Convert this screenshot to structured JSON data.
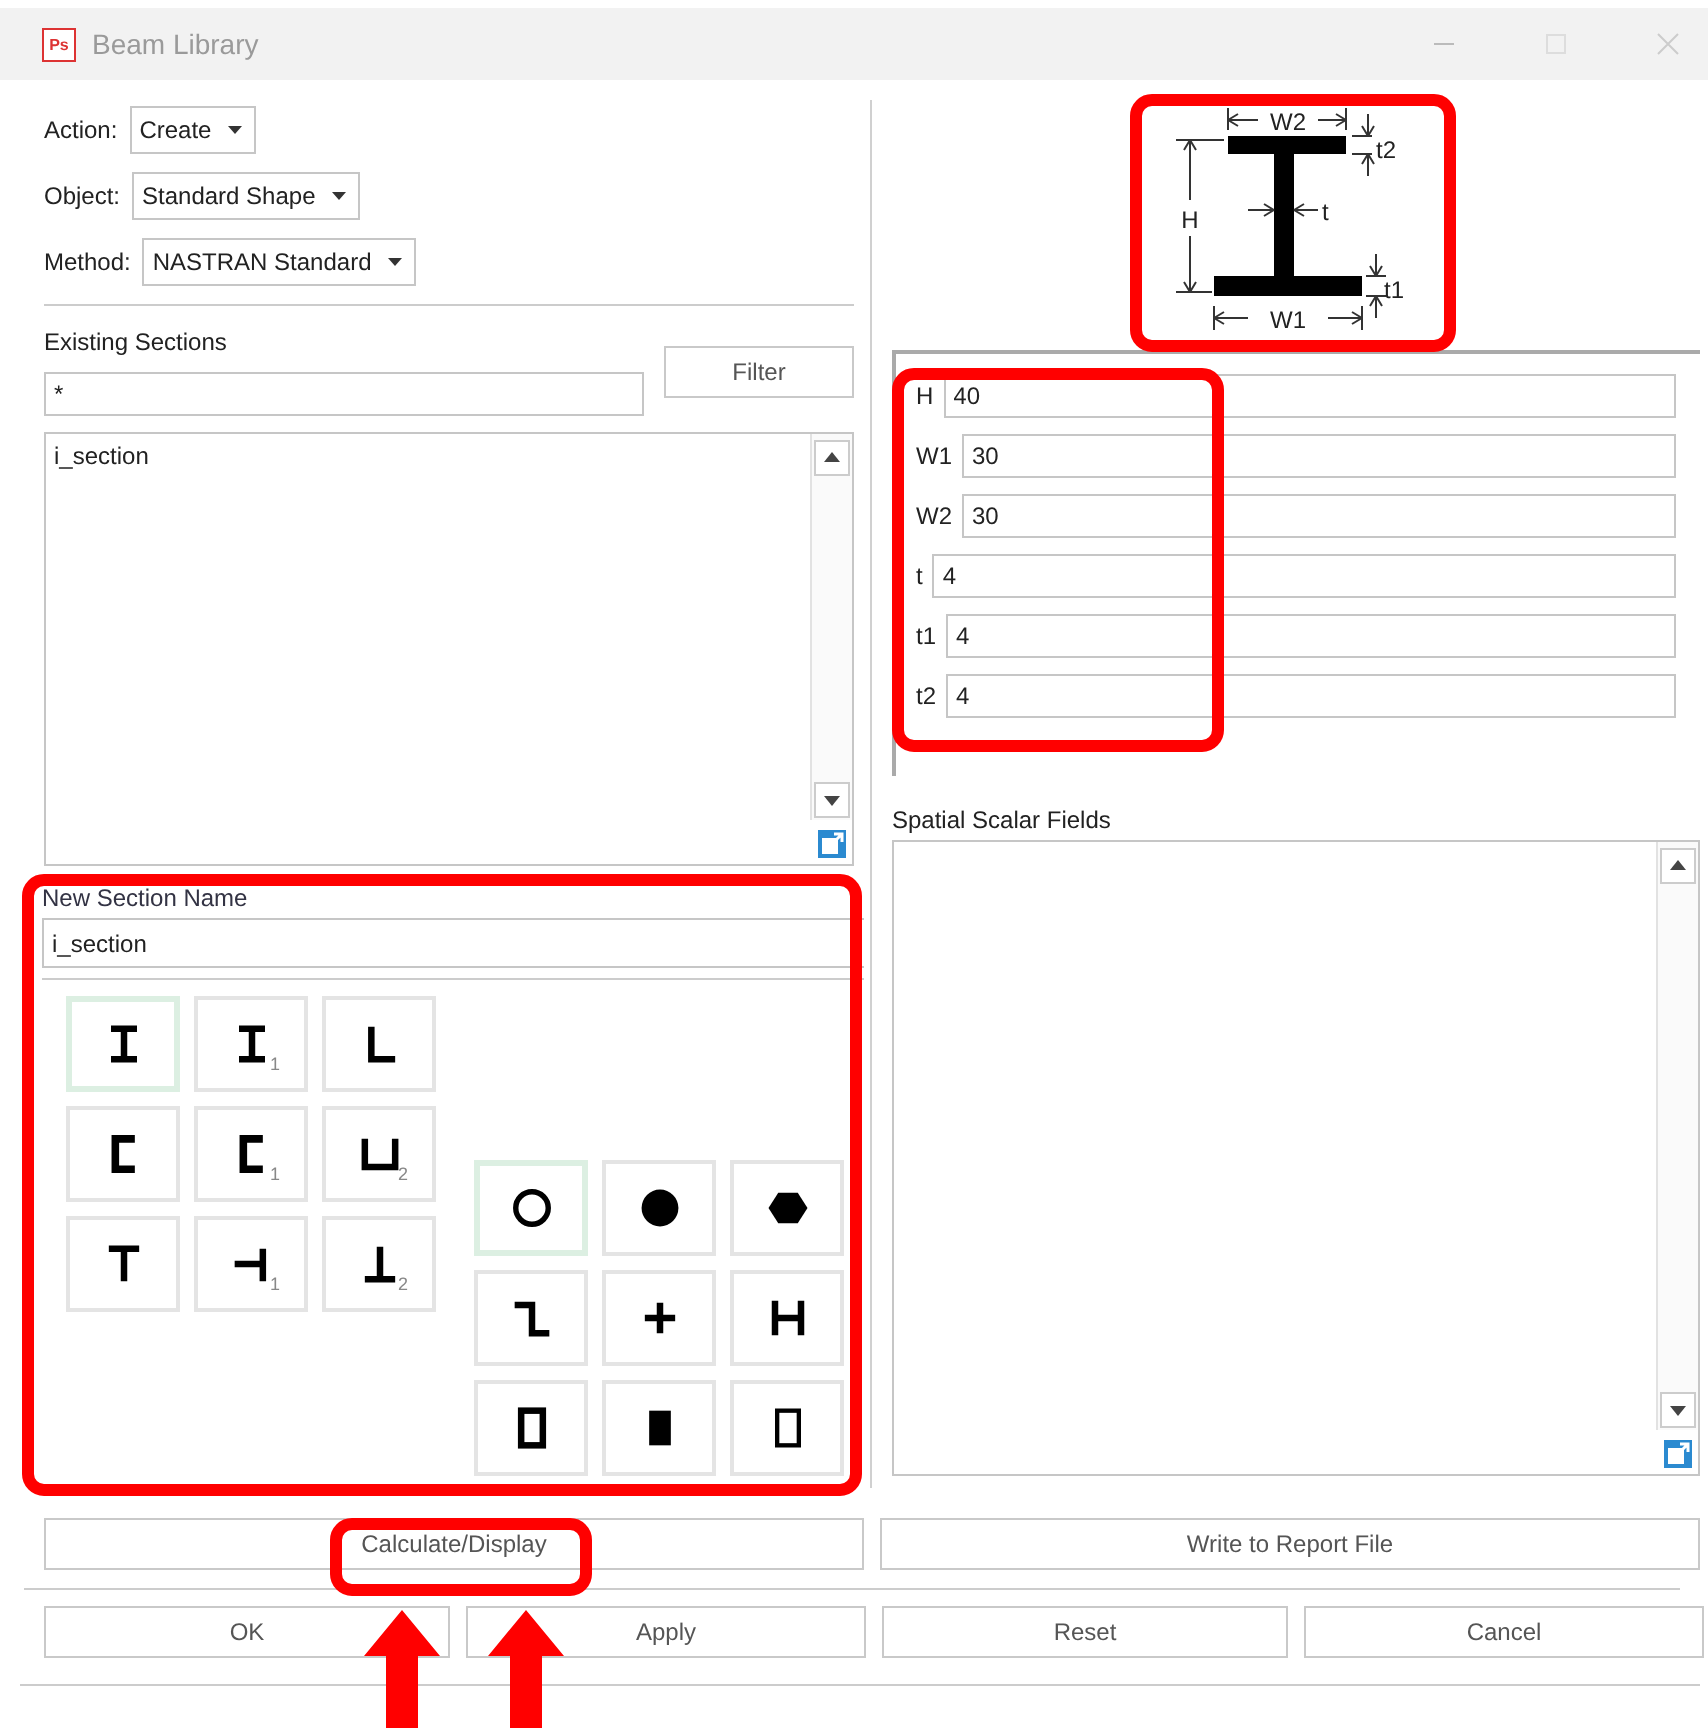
{
  "window": {
    "app_icon": "Ps",
    "title": "Beam Library"
  },
  "form": [
    {
      "label": "Action:",
      "value": "Create"
    },
    {
      "label": "Object:",
      "value": "Standard Shape"
    },
    {
      "label": "Method:",
      "value": "NASTRAN Standard"
    }
  ],
  "existing_sections": {
    "label": "Existing Sections",
    "filter_value": "*",
    "filter_button": "Filter",
    "items": [
      "i_section"
    ]
  },
  "new_section": {
    "label": "New Section Name",
    "value": "i_section"
  },
  "shapes_left": [
    {
      "kind": "i",
      "selected": true
    },
    {
      "kind": "i",
      "sub": "1",
      "selected": false
    },
    {
      "kind": "l",
      "selected": false
    },
    {
      "kind": "c",
      "selected": false
    },
    {
      "kind": "c",
      "sub": "1",
      "selected": false
    },
    {
      "kind": "u",
      "sub": "2",
      "selected": false
    },
    {
      "kind": "t",
      "selected": false
    },
    {
      "kind": "sidetee",
      "sub": "1",
      "selected": false
    },
    {
      "kind": "invt",
      "sub": "2",
      "selected": false
    }
  ],
  "shapes_right": [
    {
      "kind": "tube",
      "selected": true
    },
    {
      "kind": "rod",
      "selected": false
    },
    {
      "kind": "hex",
      "selected": false
    },
    {
      "kind": "z",
      "selected": false
    },
    {
      "kind": "cross",
      "selected": false
    },
    {
      "kind": "h",
      "selected": false
    },
    {
      "kind": "box",
      "selected": false
    },
    {
      "kind": "bar",
      "selected": false
    },
    {
      "kind": "thinbox",
      "selected": false
    }
  ],
  "diagram": {
    "labels": [
      "W2",
      "t2",
      "H",
      "t",
      "t1",
      "W1"
    ]
  },
  "parameters": [
    {
      "label": "H",
      "value": "40"
    },
    {
      "label": "W1",
      "value": "30"
    },
    {
      "label": "W2",
      "value": "30"
    },
    {
      "label": "t",
      "value": "4"
    },
    {
      "label": "t1",
      "value": "4"
    },
    {
      "label": "t2",
      "value": "4"
    }
  ],
  "spatial_scalar_fields": {
    "label": "Spatial Scalar Fields"
  },
  "actions": [
    "Calculate/Display",
    "Write to Report File"
  ],
  "buttons": [
    "OK",
    "Apply",
    "Reset",
    "Cancel"
  ]
}
